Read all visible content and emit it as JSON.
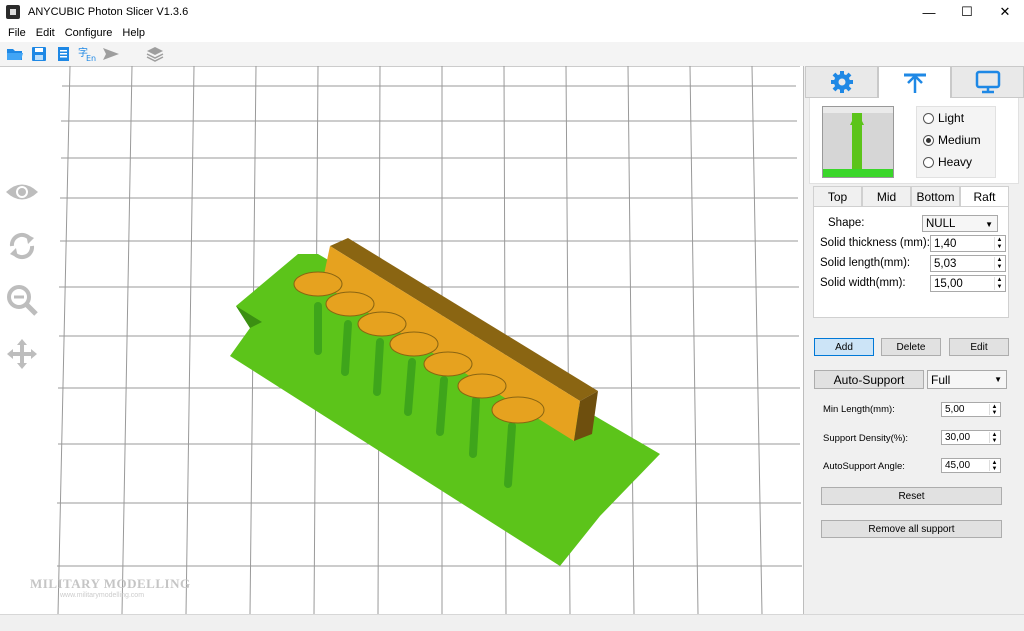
{
  "window": {
    "title": "ANYCUBIC Photon Slicer V1.3.6",
    "minimize": "—",
    "maximize": "☐",
    "close": "✕"
  },
  "menu": {
    "file": "File",
    "edit": "Edit",
    "configure": "Configure",
    "help": "Help"
  },
  "toolbar": {
    "icons": [
      "open-folder-icon",
      "save-icon",
      "document-icon",
      "language-icon",
      "send-icon",
      "layers-icon"
    ]
  },
  "viewport": {
    "tools": [
      "eye-icon",
      "rotate-icon",
      "zoom-icon",
      "move-icon"
    ],
    "watermark": "MILITARY MODELLING",
    "watermark_sub": "www.militarymodelling.com"
  },
  "colors": {
    "raft": "#5cc41a",
    "model": "#e6a21f",
    "model_dark": "#8a6512",
    "support": "#3ea51b"
  },
  "panel": {
    "tabs": [
      "settings-tab",
      "support-tab",
      "display-tab"
    ],
    "support_level": {
      "options": [
        "Light",
        "Medium",
        "Heavy"
      ],
      "selected": "Medium"
    },
    "sub_tabs": [
      "Top",
      "Mid",
      "Bottom",
      "Raft"
    ],
    "active_sub_tab": "Raft",
    "raft": {
      "shape_label": "Shape:",
      "shape_value": "NULL",
      "thickness_label": "Solid thickness (mm):",
      "thickness_value": "1,40",
      "length_label": "Solid length(mm):",
      "length_value": "5,03",
      "width_label": "Solid width(mm):",
      "width_value": "15,00"
    },
    "buttons": {
      "add": "Add",
      "delete": "Delete",
      "edit": "Edit",
      "auto_support": "Auto-Support",
      "reset": "Reset",
      "remove_all": "Remove all support"
    },
    "auto_mode": "Full",
    "params": {
      "min_length_label": "Min Length(mm):",
      "min_length_value": "5,00",
      "density_label": "Support Density(%):",
      "density_value": "30,00",
      "angle_label": "AutoSupport Angle:",
      "angle_value": "45,00"
    }
  }
}
